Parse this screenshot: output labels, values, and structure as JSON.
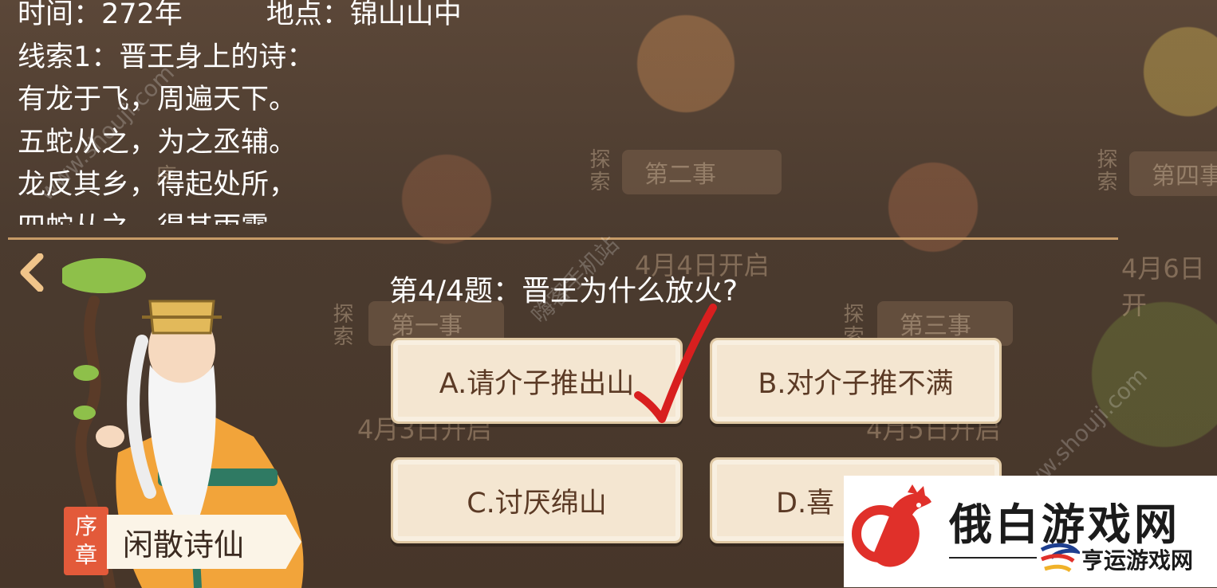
{
  "clue": {
    "lines": [
      "时间：272年　　　地点：锦山山中",
      "线索1：晋王身上的诗：",
      "有龙于飞，周遍天下。",
      "五蛇从之，为之丞辅。",
      "龙反其乡，得起处所，",
      "四蛇从之，得其雨露"
    ]
  },
  "quiz": {
    "question": "第4/4题：晋王为什么放火?",
    "options": [
      {
        "label": "A.请介子推出山",
        "correct": true
      },
      {
        "label": "B.对介子推不满",
        "correct": false
      },
      {
        "label": "C.讨厌绵山",
        "correct": false
      },
      {
        "label": "D.喜"
      }
    ]
  },
  "chapter": {
    "badge_line1": "序",
    "badge_line2": "章",
    "character_name": "闲散诗仙"
  },
  "background": {
    "banners": [
      "第二事",
      "第四事",
      "第一事",
      "第三事"
    ],
    "tags": [
      "探索",
      "探索",
      "探索",
      "探索",
      "序"
    ],
    "dates": [
      "4月4日开启",
      "4月6日开",
      "4月3日开启",
      "4月5日开启"
    ]
  },
  "watermarks": [
    "www.shouji.com",
    "嗨客手机站",
    "www.shouji.com"
  ],
  "logo": {
    "main": "俄白游戏网",
    "sub": "亨运游戏网"
  },
  "colors": {
    "accent_red": "#d81f1f",
    "option_bg": "#f4e6d1",
    "option_text": "#5b3a25"
  }
}
